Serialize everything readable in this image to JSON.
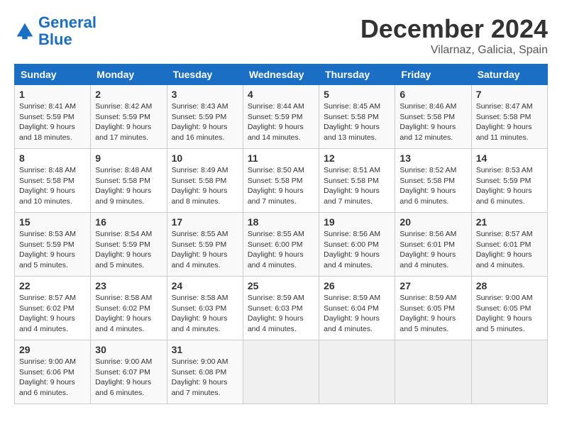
{
  "logo": {
    "line1": "General",
    "line2": "Blue"
  },
  "title": "December 2024",
  "location": "Vilarnaz, Galicia, Spain",
  "weekdays": [
    "Sunday",
    "Monday",
    "Tuesday",
    "Wednesday",
    "Thursday",
    "Friday",
    "Saturday"
  ],
  "weeks": [
    [
      {
        "day": "1",
        "sunrise": "8:41 AM",
        "sunset": "5:59 PM",
        "daylight": "9 hours and 18 minutes."
      },
      {
        "day": "2",
        "sunrise": "8:42 AM",
        "sunset": "5:59 PM",
        "daylight": "9 hours and 17 minutes."
      },
      {
        "day": "3",
        "sunrise": "8:43 AM",
        "sunset": "5:59 PM",
        "daylight": "9 hours and 16 minutes."
      },
      {
        "day": "4",
        "sunrise": "8:44 AM",
        "sunset": "5:59 PM",
        "daylight": "9 hours and 14 minutes."
      },
      {
        "day": "5",
        "sunrise": "8:45 AM",
        "sunset": "5:58 PM",
        "daylight": "9 hours and 13 minutes."
      },
      {
        "day": "6",
        "sunrise": "8:46 AM",
        "sunset": "5:58 PM",
        "daylight": "9 hours and 12 minutes."
      },
      {
        "day": "7",
        "sunrise": "8:47 AM",
        "sunset": "5:58 PM",
        "daylight": "9 hours and 11 minutes."
      }
    ],
    [
      {
        "day": "8",
        "sunrise": "8:48 AM",
        "sunset": "5:58 PM",
        "daylight": "9 hours and 10 minutes."
      },
      {
        "day": "9",
        "sunrise": "8:48 AM",
        "sunset": "5:58 PM",
        "daylight": "9 hours and 9 minutes."
      },
      {
        "day": "10",
        "sunrise": "8:49 AM",
        "sunset": "5:58 PM",
        "daylight": "9 hours and 8 minutes."
      },
      {
        "day": "11",
        "sunrise": "8:50 AM",
        "sunset": "5:58 PM",
        "daylight": "9 hours and 7 minutes."
      },
      {
        "day": "12",
        "sunrise": "8:51 AM",
        "sunset": "5:58 PM",
        "daylight": "9 hours and 7 minutes."
      },
      {
        "day": "13",
        "sunrise": "8:52 AM",
        "sunset": "5:58 PM",
        "daylight": "9 hours and 6 minutes."
      },
      {
        "day": "14",
        "sunrise": "8:53 AM",
        "sunset": "5:59 PM",
        "daylight": "9 hours and 6 minutes."
      }
    ],
    [
      {
        "day": "15",
        "sunrise": "8:53 AM",
        "sunset": "5:59 PM",
        "daylight": "9 hours and 5 minutes."
      },
      {
        "day": "16",
        "sunrise": "8:54 AM",
        "sunset": "5:59 PM",
        "daylight": "9 hours and 5 minutes."
      },
      {
        "day": "17",
        "sunrise": "8:55 AM",
        "sunset": "5:59 PM",
        "daylight": "9 hours and 4 minutes."
      },
      {
        "day": "18",
        "sunrise": "8:55 AM",
        "sunset": "6:00 PM",
        "daylight": "9 hours and 4 minutes."
      },
      {
        "day": "19",
        "sunrise": "8:56 AM",
        "sunset": "6:00 PM",
        "daylight": "9 hours and 4 minutes."
      },
      {
        "day": "20",
        "sunrise": "8:56 AM",
        "sunset": "6:01 PM",
        "daylight": "9 hours and 4 minutes."
      },
      {
        "day": "21",
        "sunrise": "8:57 AM",
        "sunset": "6:01 PM",
        "daylight": "9 hours and 4 minutes."
      }
    ],
    [
      {
        "day": "22",
        "sunrise": "8:57 AM",
        "sunset": "6:02 PM",
        "daylight": "9 hours and 4 minutes."
      },
      {
        "day": "23",
        "sunrise": "8:58 AM",
        "sunset": "6:02 PM",
        "daylight": "9 hours and 4 minutes."
      },
      {
        "day": "24",
        "sunrise": "8:58 AM",
        "sunset": "6:03 PM",
        "daylight": "9 hours and 4 minutes."
      },
      {
        "day": "25",
        "sunrise": "8:59 AM",
        "sunset": "6:03 PM",
        "daylight": "9 hours and 4 minutes."
      },
      {
        "day": "26",
        "sunrise": "8:59 AM",
        "sunset": "6:04 PM",
        "daylight": "9 hours and 4 minutes."
      },
      {
        "day": "27",
        "sunrise": "8:59 AM",
        "sunset": "6:05 PM",
        "daylight": "9 hours and 5 minutes."
      },
      {
        "day": "28",
        "sunrise": "9:00 AM",
        "sunset": "6:05 PM",
        "daylight": "9 hours and 5 minutes."
      }
    ],
    [
      {
        "day": "29",
        "sunrise": "9:00 AM",
        "sunset": "6:06 PM",
        "daylight": "9 hours and 6 minutes."
      },
      {
        "day": "30",
        "sunrise": "9:00 AM",
        "sunset": "6:07 PM",
        "daylight": "9 hours and 6 minutes."
      },
      {
        "day": "31",
        "sunrise": "9:00 AM",
        "sunset": "6:08 PM",
        "daylight": "9 hours and 7 minutes."
      },
      null,
      null,
      null,
      null
    ]
  ]
}
